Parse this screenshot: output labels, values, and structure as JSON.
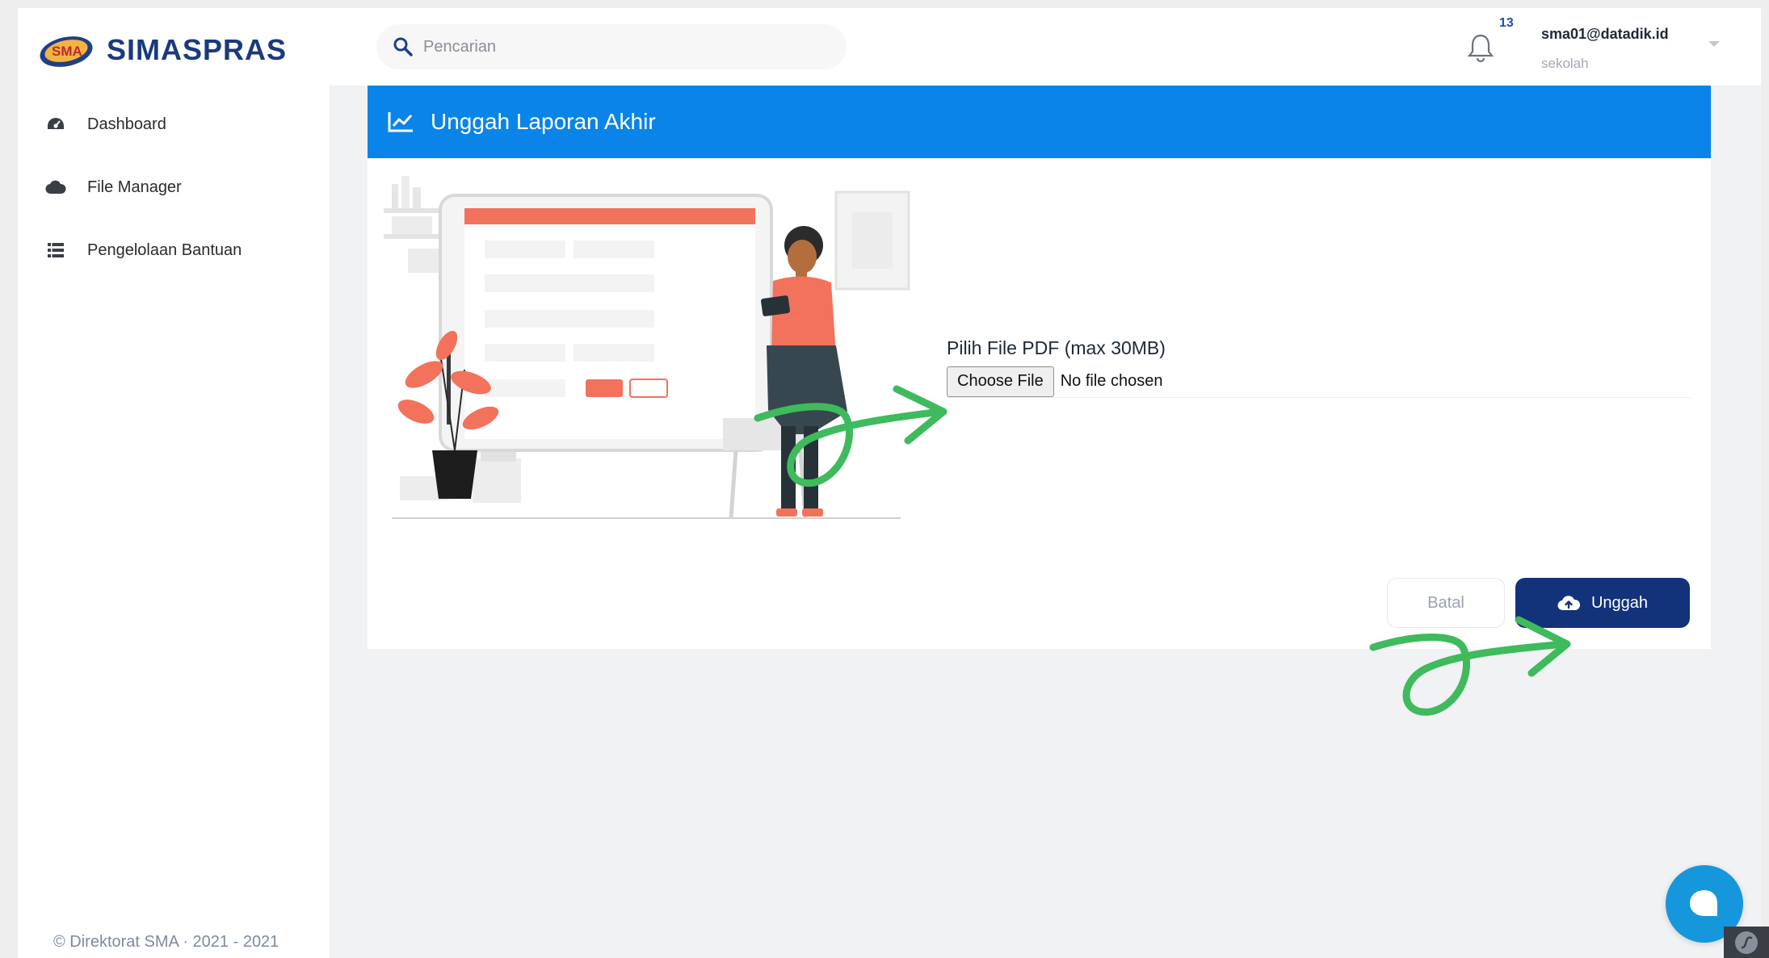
{
  "app": {
    "name": "SIMASPRAS"
  },
  "sidebar": {
    "items": [
      {
        "label": "Dashboard",
        "icon": "dashboard-icon"
      },
      {
        "label": "File Manager",
        "icon": "cloud-icon"
      },
      {
        "label": "Pengelolaan Bantuan",
        "icon": "list-icon"
      }
    ],
    "footer": "© Direktorat SMA · 2021 - 2021"
  },
  "header": {
    "search_placeholder": "Pencarian",
    "notification_count": "13",
    "user_email": "sma01@datadik.id",
    "user_role": "sekolah"
  },
  "card": {
    "title": "Unggah Laporan Akhir",
    "file_label": "Pilih File PDF (max 30MB)",
    "choose_file": "Choose File",
    "no_file": "No file chosen",
    "cancel_label": "Batal",
    "upload_label": "Unggah"
  },
  "colors": {
    "primary_blue": "#0a84e8",
    "navy": "#12327a",
    "annotation_green": "#3fba5c",
    "accent_coral": "#f3725b"
  }
}
